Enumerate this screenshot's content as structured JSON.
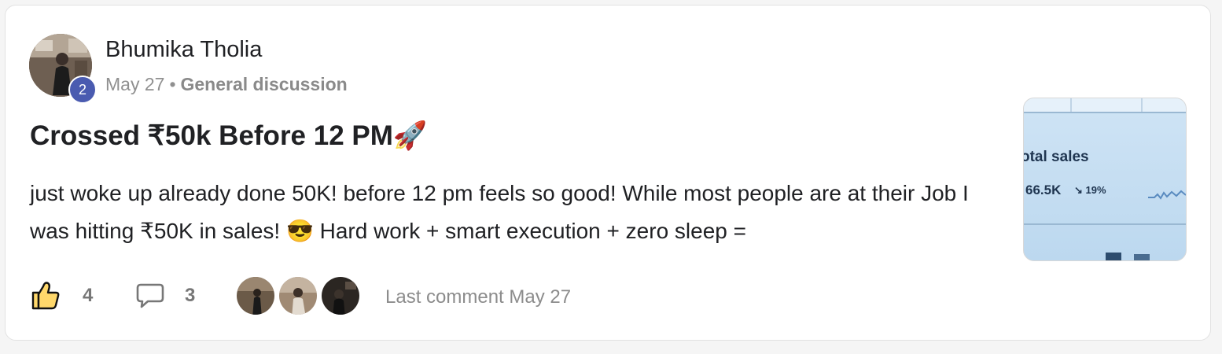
{
  "post": {
    "author": {
      "name": "Bhumika Tholia",
      "level": "2"
    },
    "date": "May 27",
    "separator": "•",
    "category": "General discussion",
    "title": "Crossed ₹50k Before 12 PM🚀",
    "body": "just woke up already done 50K! before 12 pm feels so good! While most people are at their Job I was hitting ₹50K in sales! 😎 Hard work + smart execution + zero sleep =",
    "thumbnail": {
      "label": "otal sales",
      "value": "66.5K",
      "change": "↘ 19%"
    }
  },
  "footer": {
    "likes": "4",
    "comments": "3",
    "last_comment": "Last comment May 27"
  },
  "colors": {
    "badge": "#4a5bb0",
    "text": "#202124",
    "muted": "#909090"
  },
  "icons": {
    "like": "thumbs-up-icon",
    "comment": "speech-bubble-icon"
  }
}
